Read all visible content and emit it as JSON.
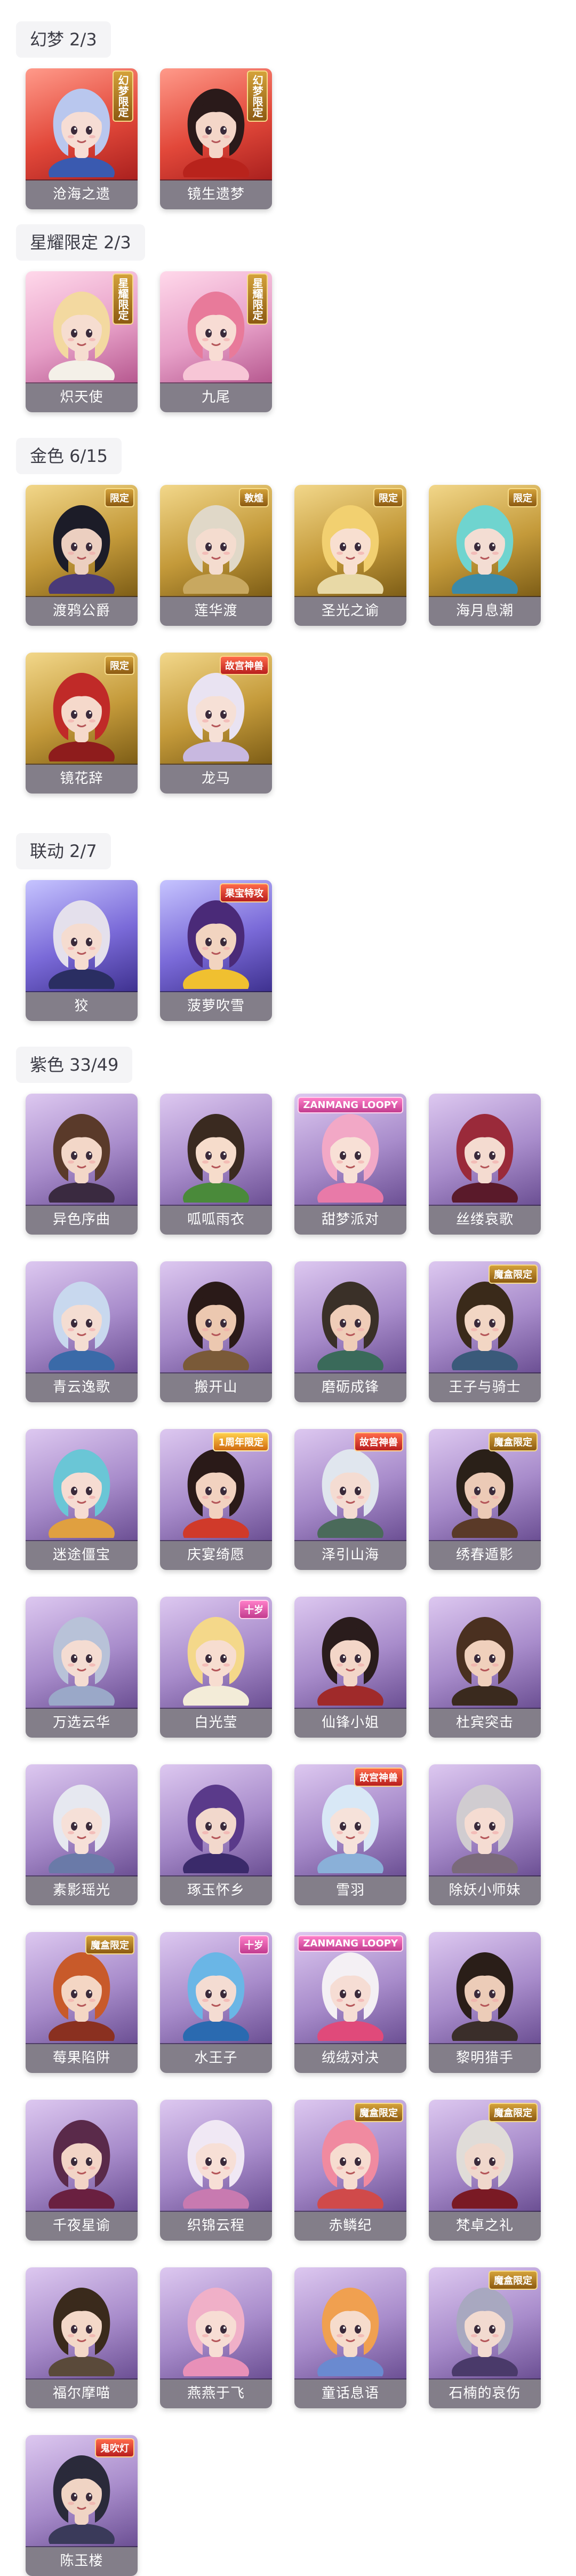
{
  "sections": [
    {
      "header": "幻梦 2/3",
      "frame": "dream",
      "items": [
        {
          "name": "沧海之遗",
          "badge": "幻梦限定",
          "badge_style": "vert",
          "hair": "#b9c7ee",
          "skin": "#f6ddd4",
          "outfit": "#3a5ab0"
        },
        {
          "name": "镜生遗梦",
          "badge": "幻梦限定",
          "badge_style": "vert",
          "hair": "#2a1a1a",
          "skin": "#f4d6c8",
          "outfit": "#b8231c"
        }
      ]
    },
    {
      "header": "星耀限定 2/3",
      "frame": "star",
      "items": [
        {
          "name": "炽天使",
          "badge": "星耀限定",
          "badge_style": "vert",
          "hair": "#f3d9a0",
          "skin": "#f6ddd0",
          "outfit": "#f4f0e8"
        },
        {
          "name": "九尾",
          "badge": "星耀限定",
          "badge_style": "vert",
          "hair": "#e87a9a",
          "skin": "#f8dcd4",
          "outfit": "#f7c6d6"
        }
      ]
    },
    {
      "header": "金色 6/15",
      "frame": "gold",
      "items": [
        {
          "name": "渡鸦公爵",
          "badge": "限定",
          "badge_style": "",
          "hair": "#1c1c28",
          "skin": "#eccfc0",
          "outfit": "#4a3a78"
        },
        {
          "name": "莲华渡",
          "badge": "敦煌",
          "badge_style": "",
          "hair": "#e0d8c8",
          "skin": "#f4dccf",
          "outfit": "#c8a860"
        },
        {
          "name": "圣光之谕",
          "badge": "限定",
          "badge_style": "",
          "hair": "#f2d070",
          "skin": "#f8dfd0",
          "outfit": "#e8d9a6"
        },
        {
          "name": "海月息潮",
          "badge": "限定",
          "badge_style": "",
          "hair": "#6fd4cf",
          "skin": "#f3ddd3",
          "outfit": "#3a8aa8"
        },
        {
          "name": "镜花辞",
          "badge": "限定",
          "badge_style": "",
          "hair": "#c02a28",
          "skin": "#f5d9cb",
          "outfit": "#8e1c1c"
        },
        {
          "name": "龙马",
          "badge": "故宫神兽",
          "badge_style": "cross",
          "hair": "#e9e3f2",
          "skin": "#f6e0d6",
          "outfit": "#c8b8e0"
        }
      ]
    },
    {
      "header": "联动 2/7",
      "frame": "collab",
      "items": [
        {
          "name": "狡",
          "badge": "",
          "badge_style": "",
          "hair": "#e4e0ec",
          "skin": "#f5dcd0",
          "outfit": "#2a2e62"
        },
        {
          "name": "菠萝吹雪",
          "badge": "果宝特攻",
          "badge_style": "cross",
          "hair": "#4a2a78",
          "skin": "#f2d4c0",
          "outfit": "#f0c030"
        }
      ]
    },
    {
      "header": "紫色 33/49",
      "frame": "purple",
      "items": [
        {
          "name": "异色序曲",
          "badge": "",
          "badge_style": "",
          "hair": "#5a3a2a",
          "skin": "#f3d7c8",
          "outfit": "#3a2a40"
        },
        {
          "name": "呱呱雨衣",
          "badge": "",
          "badge_style": "",
          "hair": "#3a2a20",
          "skin": "#f6dccb",
          "outfit": "#4a8a3a"
        },
        {
          "name": "甜梦派对",
          "badge": "ZANMANG LOOPY",
          "badge_style": "loopy",
          "hair": "#f2a8c6",
          "skin": "#f8e0d6",
          "outfit": "#e87aa8"
        },
        {
          "name": "丝缕哀歌",
          "badge": "",
          "badge_style": "",
          "hair": "#9a2a3a",
          "skin": "#f4dbd0",
          "outfit": "#5a1a2a"
        },
        {
          "name": "青云逸歌",
          "badge": "",
          "badge_style": "",
          "hair": "#c8d8ee",
          "skin": "#f4ddd2",
          "outfit": "#3a6aa8"
        },
        {
          "name": "搬开山",
          "badge": "",
          "badge_style": "",
          "hair": "#2a1a18",
          "skin": "#ecc8b0",
          "outfit": "#7a5a38"
        },
        {
          "name": "磨砺成锋",
          "badge": "",
          "badge_style": "",
          "hair": "#3a3028",
          "skin": "#efcdb8",
          "outfit": "#3a6a5a"
        },
        {
          "name": "王子与骑士",
          "badge": "魔盒限定",
          "badge_style": "",
          "hair": "#3a2a1a",
          "skin": "#f2d6c4",
          "outfit": "#3a5a7a"
        },
        {
          "name": "迷途僵宝",
          "badge": "",
          "badge_style": "",
          "hair": "#6ac6d6",
          "skin": "#f6dcd2",
          "outfit": "#e0a040"
        },
        {
          "name": "庆宴绮愿",
          "badge": "1周年限定",
          "badge_style": "anniv",
          "hair": "#2a1a18",
          "skin": "#f2d2c0",
          "outfit": "#d03a2a"
        },
        {
          "name": "泽引山海",
          "badge": "故宫神兽",
          "badge_style": "cross",
          "hair": "#e0e6ee",
          "skin": "#f4dcd2",
          "outfit": "#4a6a5a"
        },
        {
          "name": "绣春遁影",
          "badge": "魔盒限定",
          "badge_style": "",
          "hair": "#2a2018",
          "skin": "#eccab6",
          "outfit": "#5a3a28"
        },
        {
          "name": "万选云华",
          "badge": "",
          "badge_style": "",
          "hair": "#b8c2d8",
          "skin": "#f4dcd2",
          "outfit": "#9aa8c8"
        },
        {
          "name": "白光莹",
          "badge": "十岁",
          "badge_style": "loopy",
          "hair": "#f4d88a",
          "skin": "#f7ddd0",
          "outfit": "#f3ecd8"
        },
        {
          "name": "仙锋小姐",
          "badge": "",
          "badge_style": "",
          "hair": "#2a1c1c",
          "skin": "#f3d6c8",
          "outfit": "#a02a2a"
        },
        {
          "name": "杜宾突击",
          "badge": "",
          "badge_style": "",
          "hair": "#4a3020",
          "skin": "#f0d0bc",
          "outfit": "#3a2a1e"
        },
        {
          "name": "素影瑶光",
          "badge": "",
          "badge_style": "",
          "hair": "#e6e8f0",
          "skin": "#f6e0d8",
          "outfit": "#6a7aa8"
        },
        {
          "name": "琢玉怀乡",
          "badge": "",
          "badge_style": "",
          "hair": "#5a3a8a",
          "skin": "#f2d8cc",
          "outfit": "#3a2a6a"
        },
        {
          "name": "雪羽",
          "badge": "故宫神兽",
          "badge_style": "cross",
          "hair": "#d8e8f6",
          "skin": "#f6e2da",
          "outfit": "#8ab0d8"
        },
        {
          "name": "除妖小师妹",
          "badge": "",
          "badge_style": "",
          "hair": "#d0ccd0",
          "skin": "#f5dcd2",
          "outfit": "#7a6a7a"
        },
        {
          "name": "莓果陷阱",
          "badge": "魔盒限定",
          "badge_style": "",
          "hair": "#c85a2a",
          "skin": "#f4d6c4",
          "outfit": "#8a3020"
        },
        {
          "name": "水王子",
          "badge": "十岁",
          "badge_style": "loopy",
          "hair": "#6ab6e6",
          "skin": "#f4dcd2",
          "outfit": "#2a6ab0"
        },
        {
          "name": "绒绒对决",
          "badge": "ZANMANG LOOPY",
          "badge_style": "loopy",
          "hair": "#f4f0f4",
          "skin": "#f6ddd4",
          "outfit": "#e04a7a"
        },
        {
          "name": "黎明猎手",
          "badge": "",
          "badge_style": "",
          "hair": "#2a1e18",
          "skin": "#ecccb8",
          "outfit": "#3a2e2a"
        },
        {
          "name": "千夜星谕",
          "badge": "",
          "badge_style": "",
          "hair": "#5a2a4a",
          "skin": "#f2d4c6",
          "outfit": "#6a2040"
        },
        {
          "name": "织锦云程",
          "badge": "",
          "badge_style": "",
          "hair": "#f0e8f4",
          "skin": "#f7dfd6",
          "outfit": "#c87ab0"
        },
        {
          "name": "赤鳞纪",
          "badge": "魔盒限定",
          "badge_style": "",
          "hair": "#f08aa0",
          "skin": "#f6dcd0",
          "outfit": "#d04a4a"
        },
        {
          "name": "梵卓之礼",
          "badge": "魔盒限定",
          "badge_style": "",
          "hair": "#e0dcd8",
          "skin": "#f0d8cc",
          "outfit": "#7a1a24"
        },
        {
          "name": "福尔摩喵",
          "badge": "",
          "badge_style": "",
          "hair": "#3a2a1c",
          "skin": "#f3d8c8",
          "outfit": "#5a4a3a"
        },
        {
          "name": "燕燕于飞",
          "badge": "",
          "badge_style": "",
          "hair": "#f0b0c8",
          "skin": "#f7ddd4",
          "outfit": "#e890b8"
        },
        {
          "name": "童话息语",
          "badge": "",
          "badge_style": "",
          "hair": "#f0a050",
          "skin": "#f6dccc",
          "outfit": "#6a8ad0"
        },
        {
          "name": "石楠的哀伤",
          "badge": "魔盒限定",
          "badge_style": "",
          "hair": "#a8a8c0",
          "skin": "#f2dad0",
          "outfit": "#4a3a6a"
        },
        {
          "name": "陈玉楼",
          "badge": "鬼吹灯",
          "badge_style": "cross",
          "hair": "#2a2a3a",
          "skin": "#f0d4c4",
          "outfit": "#3a3a5a"
        }
      ]
    }
  ]
}
